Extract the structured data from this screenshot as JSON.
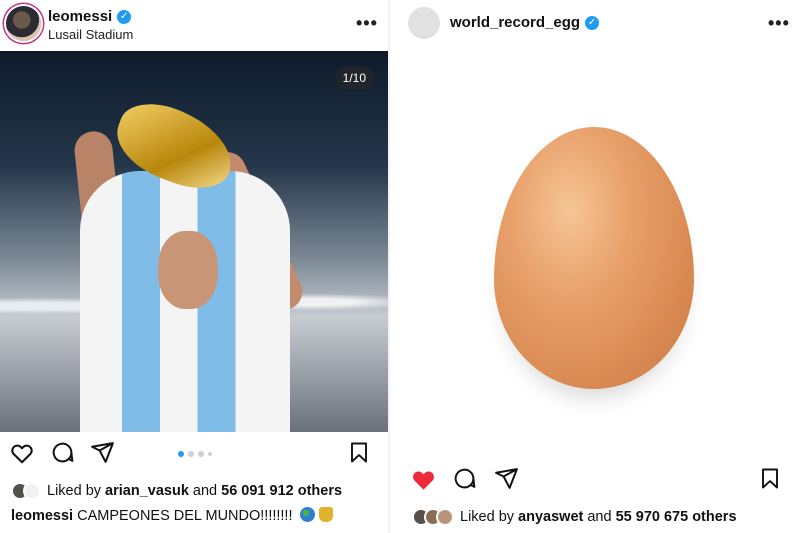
{
  "posts": [
    {
      "username": "leomessi",
      "verified": true,
      "location": "Lusail Stadium",
      "more_label": "•••",
      "slide_counter": "1/10",
      "carousel_dots": 4,
      "liked": false,
      "likes_prefix": "Liked by ",
      "likes_user": "arian_vasuk",
      "likes_mid": " and ",
      "likes_count": "56 091 912 others",
      "caption_user": "leomessi",
      "caption_text": " CAMPEONES DEL MUNDO!!!!!!!! "
    },
    {
      "username": "world_record_egg",
      "verified": true,
      "more_label": "•••",
      "liked": true,
      "likes_prefix": "Liked by ",
      "likes_user": "anyaswet",
      "likes_mid": " and ",
      "likes_count": "55 970 675 others"
    }
  ],
  "colors": {
    "verified": "#1f9bf0",
    "liked_heart": "#ee2a3a",
    "active_dot": "#1f9bf0"
  },
  "icons": [
    "verified-badge-icon",
    "more-icon",
    "heart-icon",
    "comment-icon",
    "share-icon",
    "bookmark-icon"
  ]
}
